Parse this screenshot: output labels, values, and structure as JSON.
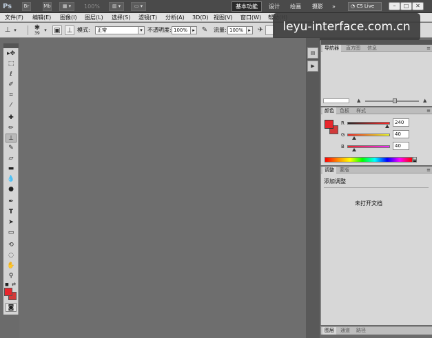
{
  "titlebar": {
    "app_logo": "Ps",
    "mb_btn": "Mb",
    "zoom_value": "100%",
    "workspaces": [
      "基本功能",
      "设计",
      "绘画",
      "摄影"
    ],
    "more": "»",
    "cs_live": "CS Live"
  },
  "menubar": {
    "items": [
      "文件(F)",
      "编辑(E)",
      "图像(I)",
      "图层(L)",
      "选择(S)",
      "滤镜(T)",
      "分析(A)",
      "3D(D)",
      "视图(V)",
      "窗口(W)",
      "帮助(H)"
    ]
  },
  "options": {
    "brush_size": "39",
    "mode_label": "模式:",
    "mode_value": "正常",
    "opacity_label": "不透明度:",
    "opacity_value": "100%",
    "flow_label": "流量:",
    "flow_value": "100%"
  },
  "watermark": "leyu-interface.com.cn",
  "navigator": {
    "tabs": [
      "导航器",
      "直方图",
      "信息"
    ]
  },
  "color": {
    "tabs": [
      "颜色",
      "色板",
      "样式"
    ],
    "channels": [
      {
        "label": "R",
        "value": "240"
      },
      {
        "label": "G",
        "value": "40"
      },
      {
        "label": "B",
        "value": "40"
      }
    ],
    "fg_color": "#e8262c"
  },
  "adjustments": {
    "tabs": [
      "调整",
      "蒙版"
    ],
    "title": "添加调整",
    "empty_text": "未打开文档"
  },
  "layers": {
    "tabs": [
      "图层",
      "通道",
      "路径"
    ]
  }
}
